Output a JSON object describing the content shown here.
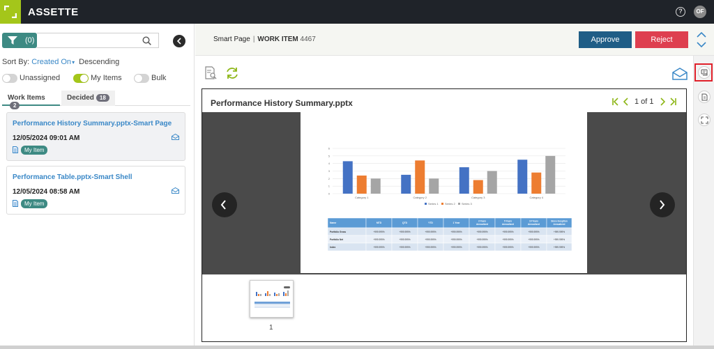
{
  "app": {
    "brand": "ASSETTE",
    "help_glyph": "?",
    "user_initials": "OF"
  },
  "filter": {
    "count": "(0)",
    "search_placeholder": ""
  },
  "sort": {
    "prefix": "Sort By:",
    "field": "Created On",
    "order": "Descending"
  },
  "toggles": [
    {
      "label": "Unassigned",
      "on": false
    },
    {
      "label": "My Items",
      "on": true
    },
    {
      "label": "Bulk",
      "on": false
    }
  ],
  "tabs": [
    {
      "label": "Work Items",
      "count": "2"
    },
    {
      "label": "Decided",
      "count": "18"
    }
  ],
  "items": [
    {
      "title": "Performance History Summary.pptx-Smart Page",
      "date": "12/05/2024 09:01 AM",
      "chip": "My Item"
    },
    {
      "title": "Performance Table.pptx-Smart Shell",
      "date": "12/05/2024 08:58 AM",
      "chip": "My Item"
    }
  ],
  "header": {
    "page_type": "Smart Page",
    "separator": "|",
    "work_item_label": "WORK ITEM",
    "work_item_id": "4467",
    "approve_label": "Approve",
    "reject_label": "Reject"
  },
  "viewer": {
    "title": "Performance History Summary.pptx",
    "page_text": "1 of 1",
    "thumb_page": "1"
  },
  "colors": {
    "brand_green": "#a4c61a",
    "teal": "#3d8a83",
    "approve": "#1f5d86",
    "reject": "#de3f4f",
    "link": "#3a88c7"
  },
  "chart_data": {
    "type": "bar",
    "categories": [
      "Category 1",
      "Category 2",
      "Category 3",
      "Category 4"
    ],
    "series": [
      {
        "name": "Series 1",
        "values": [
          4.3,
          2.5,
          3.5,
          4.5
        ],
        "color": "#4472c4"
      },
      {
        "name": "Series 2",
        "values": [
          2.4,
          4.4,
          1.8,
          2.8
        ],
        "color": "#ed7d31"
      },
      {
        "name": "Series 3",
        "values": [
          2,
          2,
          3,
          5
        ],
        "color": "#a5a5a5"
      }
    ],
    "ylim": [
      0,
      6
    ],
    "yticks": [
      "0",
      "1",
      "2",
      "3",
      "4",
      "5",
      "6"
    ],
    "legend": "bottom",
    "table": {
      "headers": [
        "Name",
        "MTD",
        "QTD",
        "YTD",
        "1 Year",
        "3 Years Annualized",
        "5 Years Annualized",
        "10 Years Annualized",
        "Since Inception Annualized"
      ],
      "rows": [
        [
          "Portfolio Gross",
          "+999.999%",
          "+999.999%",
          "+999.999%",
          "+999.999%",
          "+999.999%",
          "+999.999%",
          "+999.999%",
          "+999.999%"
        ],
        [
          "Portfolio Net",
          "+999.999%",
          "+999.999%",
          "+999.999%",
          "+999.999%",
          "+999.999%",
          "+999.999%",
          "+999.999%",
          "+999.999%"
        ],
        [
          "Index",
          "+999.999%",
          "+999.999%",
          "+999.999%",
          "+999.999%",
          "+999.999%",
          "+999.999%",
          "+999.999%",
          "+999.999%"
        ]
      ]
    }
  }
}
